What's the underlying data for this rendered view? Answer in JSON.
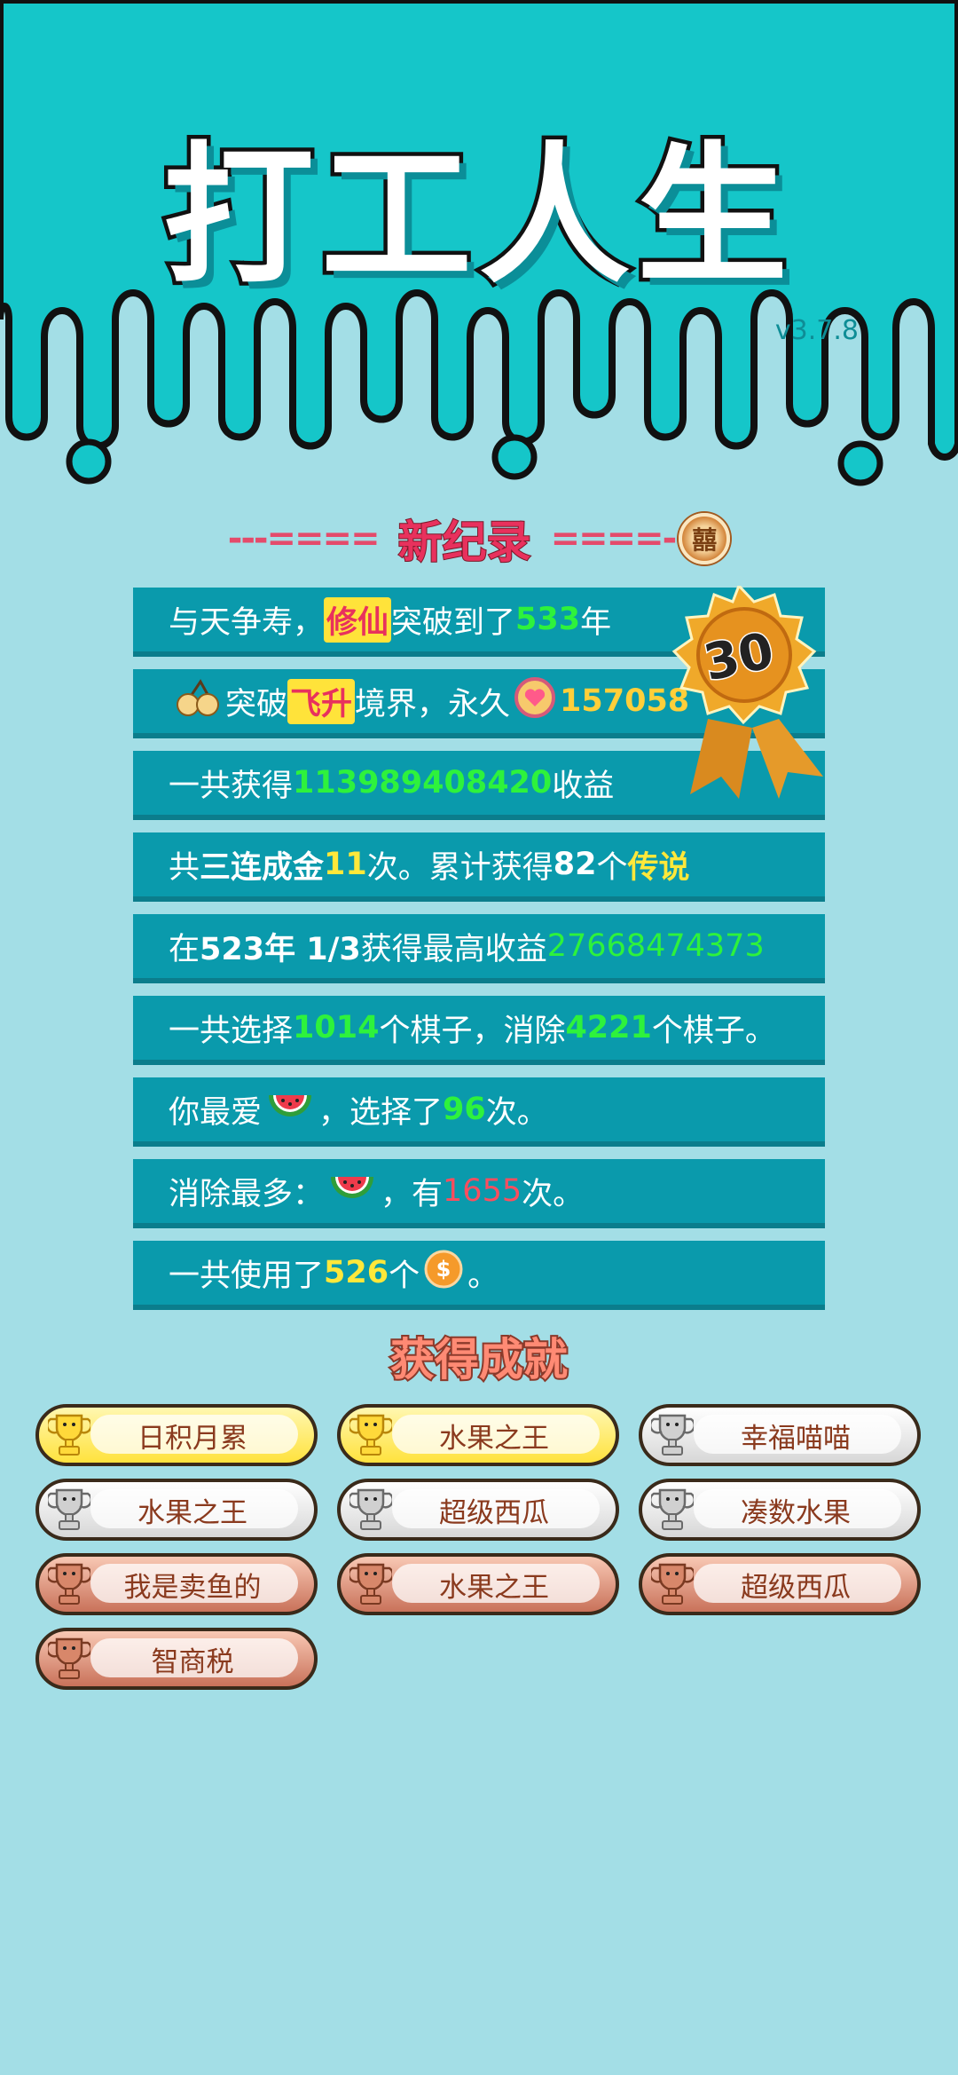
{
  "header": {
    "title": "打工人生",
    "version": "v3.7.8"
  },
  "record": {
    "left_dashes": "---====",
    "title": "新纪录",
    "right_dashes": "====-",
    "badge_glyph": "囍"
  },
  "medal": {
    "number": "30"
  },
  "stats": {
    "row1": {
      "a": "与天争寿，",
      "b": "修仙",
      "c": "突破到了",
      "d": "533",
      "e": "年"
    },
    "row2": {
      "a": "突破",
      "b": "飞升",
      "c": "境界，永久",
      "d": "157058"
    },
    "row3": {
      "a": "一共获得",
      "b": "113989408420",
      "c": "收益"
    },
    "row4": {
      "a": "共",
      "b": "三连成金",
      "c": "11",
      "d": "次。累计获得",
      "e": "82",
      "f": "个",
      "g": "传说"
    },
    "row5": {
      "a": "在 ",
      "b": "523年 1/3",
      "c": " 获得最高收益",
      "d": "27668474373"
    },
    "row6": {
      "a": "一共选择",
      "b": "1014",
      "c": "个棋子，消除",
      "d": "4221",
      "e": "个棋子。"
    },
    "row7": {
      "a": "你最爱",
      "b": "，选择了",
      "c": "96",
      "d": "次。"
    },
    "row8": {
      "a": "消除最多：",
      "b": "，有",
      "c": "1655",
      "d": "次。"
    },
    "row9": {
      "a": "一共使用了",
      "b": "526",
      "c": "个",
      "d": "。"
    }
  },
  "achievements": {
    "title": "获得成就",
    "items": [
      {
        "label": "日积月累",
        "tier": "gold"
      },
      {
        "label": "水果之王",
        "tier": "gold"
      },
      {
        "label": "幸福喵喵",
        "tier": "silver"
      },
      {
        "label": "水果之王",
        "tier": "silver"
      },
      {
        "label": "超级西瓜",
        "tier": "silver"
      },
      {
        "label": "凑数水果",
        "tier": "silver"
      },
      {
        "label": "我是卖鱼的",
        "tier": "bronze"
      },
      {
        "label": "水果之王",
        "tier": "bronze"
      },
      {
        "label": "超级西瓜",
        "tier": "bronze"
      },
      {
        "label": "智商税",
        "tier": "bronze"
      }
    ]
  },
  "colors": {
    "header_bg": "#15c6c9",
    "page_bg": "#a3dee6",
    "row_bg": "#0a9aac",
    "highlight_green": "#2ef23c",
    "highlight_yellow": "#ffe83a",
    "highlight_red": "#ff4d5e"
  },
  "icons": [
    "cherry-icon",
    "heart-coin-icon",
    "watermelon-icon",
    "dollar-coin-icon",
    "trophy-icon",
    "medal-icon",
    "xi-coin-icon"
  ]
}
